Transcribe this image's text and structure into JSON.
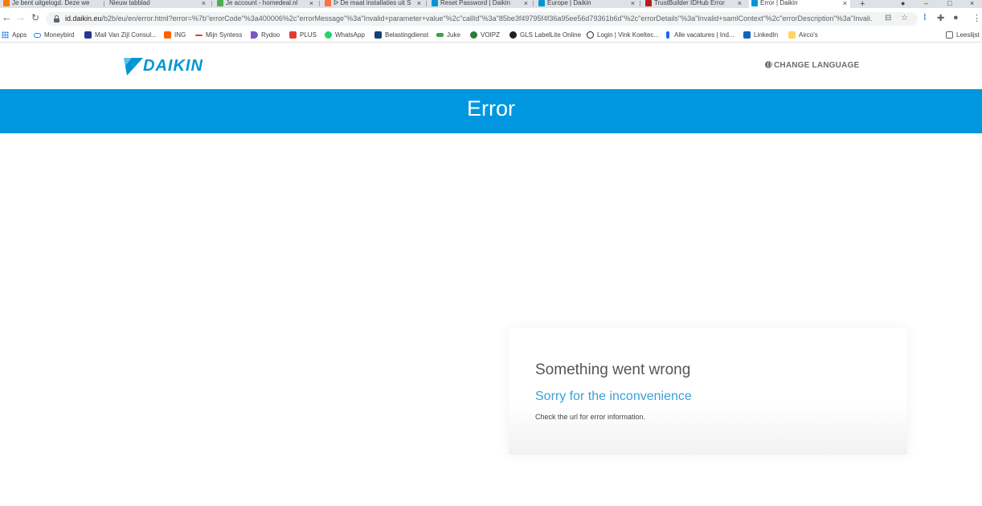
{
  "browser": {
    "tabs": [
      {
        "title": "Je bent uitgelogd. Deze we",
        "color": "#f57c00"
      },
      {
        "title": "Nieuw tabblad",
        "color": ""
      },
      {
        "title": "Je account - homedeal.nl",
        "color": "#4caf50"
      },
      {
        "title": "ᐅ De maat installaties uit S",
        "color": "#ff7043"
      },
      {
        "title": "Reset Password | Daikin",
        "color": "#0096d6"
      },
      {
        "title": "Europe | Daikin",
        "color": "#0096d6"
      },
      {
        "title": "TrustBuilder IDHub Error",
        "color": "#b71c1c"
      },
      {
        "title": "Error | Daikin",
        "color": "#0096d6"
      }
    ],
    "new_tab_symbol": "+",
    "url_host": "id.daikin.eu",
    "url_rest": "/b2b/eu/en/error.html?error=%7b\"errorCode\"%3a400006%2c\"errorMessage\"%3a\"Invalid+parameter+value\"%2c\"callId\"%3a\"85be3f49795f4f36a95ee56d79361b6d\"%2c\"errorDetails\"%3a\"Invalid+samlContext\"%2c\"errorDescription\"%3a\"Invali...",
    "bookmarks": [
      {
        "label": "Apps",
        "icon": "apps-grid-icon",
        "color": "#1a73e8"
      },
      {
        "label": "Moneybird",
        "icon": "moneybird-icon",
        "color": "#1e88e5"
      },
      {
        "label": "Mail Van Zijl Consul...",
        "icon": "mail-icon",
        "color": "#283593"
      },
      {
        "label": "ING",
        "icon": "ing-icon",
        "color": "#ff6200"
      },
      {
        "label": "Mijn Syntess",
        "icon": "syntess-icon",
        "color": "#e53935"
      },
      {
        "label": "Rydoo",
        "icon": "rydoo-icon",
        "color": "#7e57c2"
      },
      {
        "label": "PLUS",
        "icon": "plus-icon",
        "color": "#e53935"
      },
      {
        "label": "WhatsApp",
        "icon": "whatsapp-icon",
        "color": "#25d366"
      },
      {
        "label": "Belastingdienst",
        "icon": "belastingdienst-icon",
        "color": "#154273"
      },
      {
        "label": "Juke",
        "icon": "juke-icon",
        "color": "#43a047"
      },
      {
        "label": "VOIPZ",
        "icon": "voipz-icon",
        "color": "#2e7d32"
      },
      {
        "label": "GLS LabelLite Online",
        "icon": "gls-icon",
        "color": "#212121"
      },
      {
        "label": "Login | Vink Koeltec...",
        "icon": "vink-icon",
        "color": "#212121"
      },
      {
        "label": "Alle vacatures | Ind...",
        "icon": "indeed-icon",
        "color": "#2164f3"
      },
      {
        "label": "LinkedIn",
        "icon": "linkedin-icon",
        "color": "#0a66c2"
      },
      {
        "label": "Airco's",
        "icon": "folder-icon",
        "color": "#fdd663"
      }
    ],
    "reading_list": "Leeslijst"
  },
  "site": {
    "logo_text": "DAIKIN",
    "change_language": "CHANGE LANGUAGE",
    "brand_color": "#0097e0"
  },
  "banner": {
    "title": "Error"
  },
  "error_card": {
    "title": "Something went wrong",
    "subtitle": "Sorry for the inconvenience",
    "note": "Check the url for error information."
  }
}
